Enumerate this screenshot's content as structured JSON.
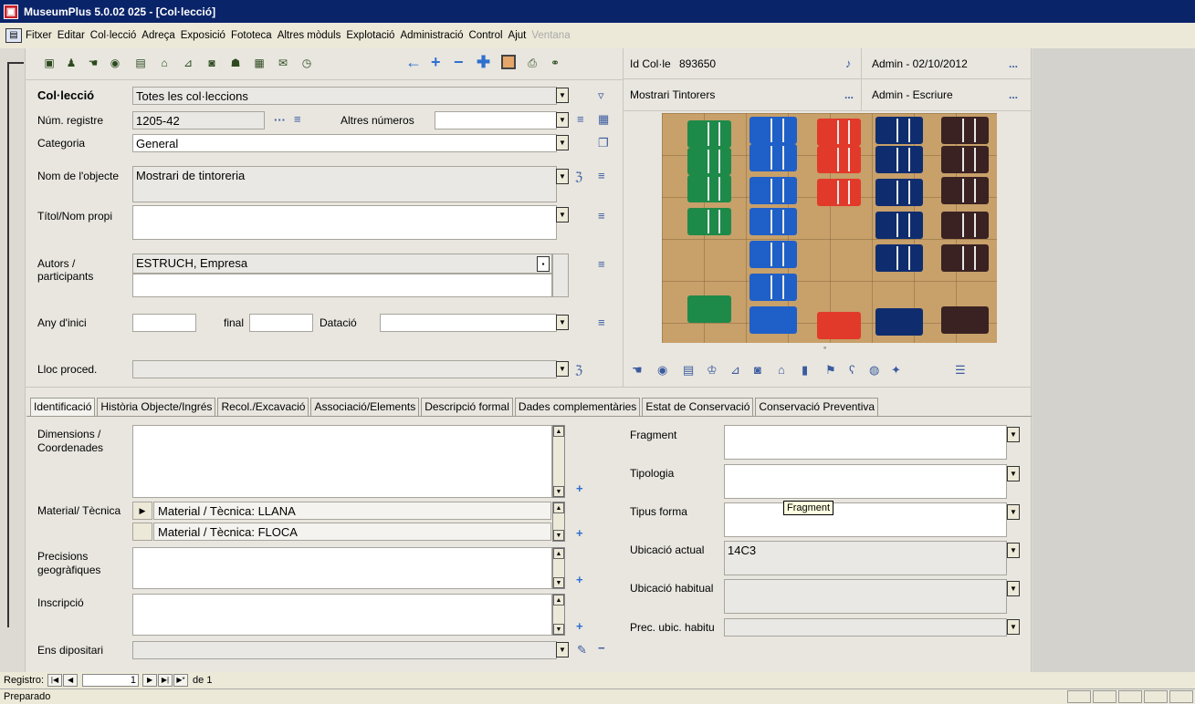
{
  "window": {
    "title": "MuseumPlus 5.0.02 025 - [Col·lecció]"
  },
  "menubar": {
    "items": [
      "Fitxer",
      "Editar",
      "Col·lecció",
      "Adreça",
      "Exposició",
      "Fototeca",
      "Altres mòduls",
      "Explotació",
      "Administració",
      "Control",
      "Ajut"
    ],
    "disabled_item": "Ventana"
  },
  "header": {
    "id_label": "Id Col·le",
    "id_value": "893650",
    "admin_date": "Admin - 02/10/2012",
    "more": "...",
    "object_title": "Mostrari Tintorers",
    "admin_write": "Admin - Escriure"
  },
  "form": {
    "colleccio_label": "Col·lecció",
    "colleccio_value": "Totes les col·leccions",
    "num_registre_label": "Núm. registre",
    "num_registre_value": "1205-42",
    "altres_numeros_label": "Altres números",
    "categoria_label": "Categoria",
    "categoria_value": "General",
    "nom_objecte_label": "Nom de l'objecte",
    "nom_objecte_value": "Mostrari de tintoreria",
    "titol_label": "Títol/Nom propi",
    "autors_label_1": "Autors /",
    "autors_label_2": "participants",
    "autors_value": "ESTRUCH, Empresa",
    "any_inici_label": "Any d'inici",
    "final_label": "final",
    "datacio_label": "Datació",
    "lloc_proced_label": "Lloc proced."
  },
  "tabs": [
    "Identificació",
    "Història Objecte/Ingrés",
    "Recol./Excavació",
    "Associació/Elements",
    "Descripció formal",
    "Dades complementàries",
    "Estat de Conservació",
    "Conservació Preventiva"
  ],
  "identificacio": {
    "dimensions_label_1": "Dimensions /",
    "dimensions_label_2": "Coordenades",
    "material_label": "Material/ Tècnica",
    "material_rows": [
      "Material / Tècnica: LLANA",
      "Material / Tècnica: FLOCA"
    ],
    "precisions_label_1": "Precisions",
    "precisions_label_2": "geogràfiques",
    "inscripcio_label": "Inscripció",
    "ens_label": "Ens dipositari",
    "fragment_label": "Fragment",
    "tipologia_label": "Tipologia",
    "tipus_forma_label": "Tipus forma",
    "ubicacio_actual_label": "Ubicació actual",
    "ubicacio_actual_value": "14C3",
    "ubicacio_habitual_label": "Ubicació habitual",
    "prec_ubic_label": "Prec. ubic. habitu",
    "tooltip": "Fragment"
  },
  "record_bar": {
    "label": "Registro:",
    "current": "1",
    "of_label": "de 1"
  },
  "status": {
    "text": "Preparado"
  },
  "colors": {
    "titlebar": "#0a246a",
    "green_swatch": "#1e8a4a",
    "blue_swatch": "#1f5fc8",
    "red_swatch": "#e23a2a",
    "navy_swatch": "#0f2d6e",
    "brown_swatch": "#3a2222"
  }
}
